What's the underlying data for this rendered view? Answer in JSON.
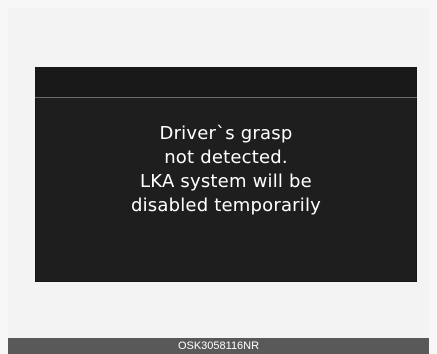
{
  "display": {
    "message_lines": [
      "Driver`s  grasp",
      "not detected.",
      "LKA system will be",
      "disabled temporarily"
    ]
  },
  "caption": {
    "code": "OSK3058116NR"
  }
}
